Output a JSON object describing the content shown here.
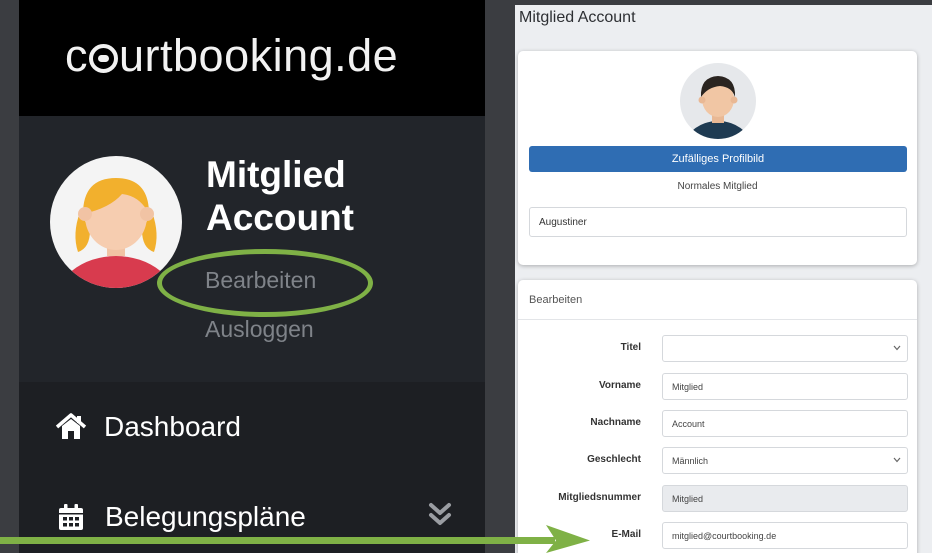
{
  "sidebar": {
    "brand": {
      "pre": "c",
      "post": "urtbooking.de"
    },
    "user": {
      "first_name": "Mitglied",
      "last_name": "Account"
    },
    "links": {
      "edit": "Bearbeiten",
      "logout": "Ausloggen"
    },
    "nav": [
      {
        "label": "Dashboard",
        "icon": "home-icon"
      },
      {
        "label": "Belegungspläne",
        "icon": "calendar-icon"
      }
    ],
    "highlight_color": "#7fb146"
  },
  "main": {
    "title": "Mitglied Account",
    "avatar_card": {
      "random_button": "Zufälliges Profilbild",
      "member_type": "Normales Mitglied",
      "club_value": "Augustiner"
    },
    "edit_card": {
      "header": "Bearbeiten",
      "fields": [
        {
          "label": "Titel",
          "value": "",
          "type": "select"
        },
        {
          "label": "Vorname",
          "value": "Mitglied",
          "type": "text"
        },
        {
          "label": "Nachname",
          "value": "Account",
          "type": "text"
        },
        {
          "label": "Geschlecht",
          "value": "Männlich",
          "type": "select"
        },
        {
          "label": "Mitgliedsnummer",
          "value": "Mitglied",
          "type": "readonly"
        },
        {
          "label": "E-Mail",
          "value": "mitglied@courtbooking.de",
          "type": "text"
        }
      ]
    },
    "accent_color": "#2f6db3"
  }
}
